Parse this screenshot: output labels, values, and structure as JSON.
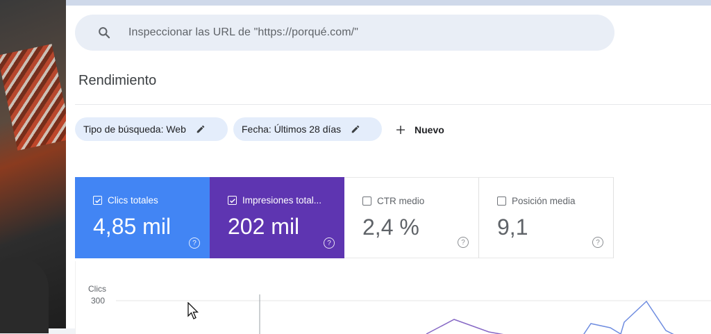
{
  "search": {
    "placeholder": "Inspeccionar las URL de \"https://porqué.com/\""
  },
  "section_title": "Rendimiento",
  "filters": [
    {
      "label": "Tipo de búsqueda: Web"
    },
    {
      "label": "Fecha: Últimos 28 días"
    }
  ],
  "new_filter_label": "Nuevo",
  "metrics": [
    {
      "label": "Clics totales",
      "value": "4,85 mil",
      "checked": true,
      "color": "#4285f4"
    },
    {
      "label": "Impresiones total...",
      "value": "202 mil",
      "checked": true,
      "color": "#5e35b1"
    },
    {
      "label": "CTR medio",
      "value": "2,4 %",
      "checked": false
    },
    {
      "label": "Posición media",
      "value": "9,1",
      "checked": false
    }
  ],
  "chart_data": {
    "type": "line",
    "ylabel": "Clics",
    "y_ticks": [
      "300"
    ],
    "series": [
      {
        "values": [],
        "color": "#4285f4"
      },
      {
        "values": [],
        "color": "#5e35b1"
      }
    ]
  },
  "icons": [
    "search-icon",
    "edit-icon",
    "plus-icon",
    "checkbox-icon",
    "help-icon",
    "cursor-icon"
  ]
}
